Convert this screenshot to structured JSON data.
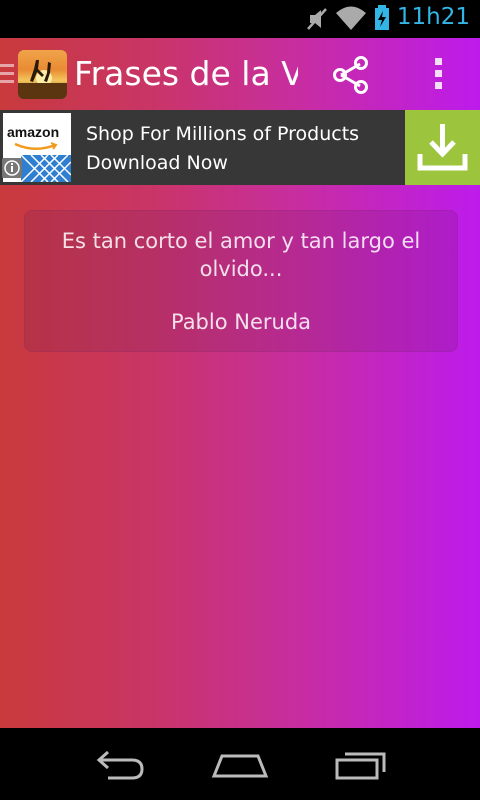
{
  "status_bar": {
    "time": "11h21",
    "icons": [
      "mute-icon",
      "wifi-icon",
      "battery-charging-icon"
    ],
    "accent_color": "#33b5e5"
  },
  "action_bar": {
    "title": "Frases de la Vida",
    "icons": [
      "drawer-icon",
      "app-icon",
      "share-icon",
      "overflow-menu-icon"
    ]
  },
  "ad": {
    "logo_text": "amazon",
    "line1": "Shop For Millions of Products",
    "line2": "Download Now",
    "icons": [
      "info-icon",
      "download-icon"
    ],
    "button_color": "#9cc43c"
  },
  "quote": {
    "text": "Es tan corto el amor y tan largo el olvido...",
    "author": "Pablo Neruda"
  },
  "nav_bar": {
    "icons": [
      "back-icon",
      "home-icon",
      "recent-apps-icon"
    ]
  },
  "colors": {
    "gradient_start": "#c83a3c",
    "gradient_end": "#bd1bec"
  }
}
